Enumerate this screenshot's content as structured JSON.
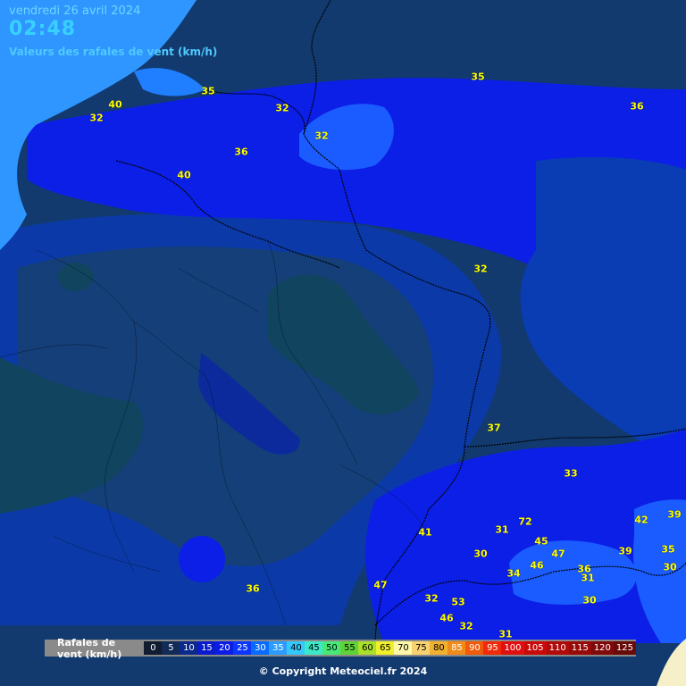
{
  "header": {
    "date": "vendredi 26 avril 2024",
    "time": "02:48",
    "subtitle": "Valeurs des rafales de vent (km/h)"
  },
  "colors": {
    "sea": "#2f96ff",
    "land_dark": "#123a6e",
    "land_mid": "#0a3cb4",
    "land_bright": "#0c1fe6",
    "land_light": "#1a5cff",
    "zone_dark": "#0f3f5a",
    "alps": "#f5f0c8",
    "value_text": "#ffff00"
  },
  "gust_values": [
    {
      "v": "40"
    },
    {
      "v": "32"
    },
    {
      "v": "35"
    },
    {
      "v": "32"
    },
    {
      "v": "32"
    },
    {
      "v": "35"
    },
    {
      "v": "36"
    },
    {
      "v": "36"
    },
    {
      "v": "40"
    },
    {
      "v": "32"
    },
    {
      "v": "37"
    },
    {
      "v": "33"
    },
    {
      "v": "41"
    },
    {
      "v": "31"
    },
    {
      "v": "72"
    },
    {
      "v": "42"
    },
    {
      "v": "39"
    },
    {
      "v": "45"
    },
    {
      "v": "47"
    },
    {
      "v": "30"
    },
    {
      "v": "46"
    },
    {
      "v": "39"
    },
    {
      "v": "35"
    },
    {
      "v": "34"
    },
    {
      "v": "36"
    },
    {
      "v": "30"
    },
    {
      "v": "31"
    },
    {
      "v": "36"
    },
    {
      "v": "47"
    },
    {
      "v": "32"
    },
    {
      "v": "53"
    },
    {
      "v": "30"
    },
    {
      "v": "46"
    },
    {
      "v": "32"
    },
    {
      "v": "31"
    }
  ],
  "legend": {
    "label": "Rafales de vent (km/h)",
    "steps": [
      {
        "v": "0",
        "c": "#101c30",
        "t": "#ffffff"
      },
      {
        "v": "5",
        "c": "#122a56",
        "t": "#ffffff"
      },
      {
        "v": "10",
        "c": "#0c2a8c",
        "t": "#ffffff"
      },
      {
        "v": "15",
        "c": "#0a1ccc",
        "t": "#ffffff"
      },
      {
        "v": "20",
        "c": "#0a1ce6",
        "t": "#ffffff"
      },
      {
        "v": "25",
        "c": "#0a36ff",
        "t": "#ffffff"
      },
      {
        "v": "30",
        "c": "#0a6cff",
        "t": "#ffffff"
      },
      {
        "v": "35",
        "c": "#2a9cff",
        "t": "#ffffff"
      },
      {
        "v": "40",
        "c": "#35c8ff",
        "t": "#000000"
      },
      {
        "v": "45",
        "c": "#3ce8c8",
        "t": "#000000"
      },
      {
        "v": "50",
        "c": "#48e878",
        "t": "#000000"
      },
      {
        "v": "55",
        "c": "#5fd23a",
        "t": "#000000"
      },
      {
        "v": "60",
        "c": "#a8e02a",
        "t": "#000000"
      },
      {
        "v": "65",
        "c": "#f0f02a",
        "t": "#000000"
      },
      {
        "v": "70",
        "c": "#fff8a8",
        "t": "#000000"
      },
      {
        "v": "75",
        "c": "#f8d270",
        "t": "#000000"
      },
      {
        "v": "80",
        "c": "#f0b030",
        "t": "#000000"
      },
      {
        "v": "85",
        "c": "#f08a18",
        "t": "#ffffff"
      },
      {
        "v": "90",
        "c": "#f05a0a",
        "t": "#ffffff"
      },
      {
        "v": "95",
        "c": "#f02a0a",
        "t": "#ffffff"
      },
      {
        "v": "100",
        "c": "#e01010",
        "t": "#ffffff"
      },
      {
        "v": "105",
        "c": "#c80a0a",
        "t": "#ffffff"
      },
      {
        "v": "110",
        "c": "#b00a0a",
        "t": "#ffffff"
      },
      {
        "v": "115",
        "c": "#980a0a",
        "t": "#ffffff"
      },
      {
        "v": "120",
        "c": "#800a0a",
        "t": "#ffffff"
      },
      {
        "v": "125",
        "c": "#680a0a",
        "t": "#ffffff"
      }
    ]
  },
  "copyright": "© Copyright Meteociel.fr 2024"
}
